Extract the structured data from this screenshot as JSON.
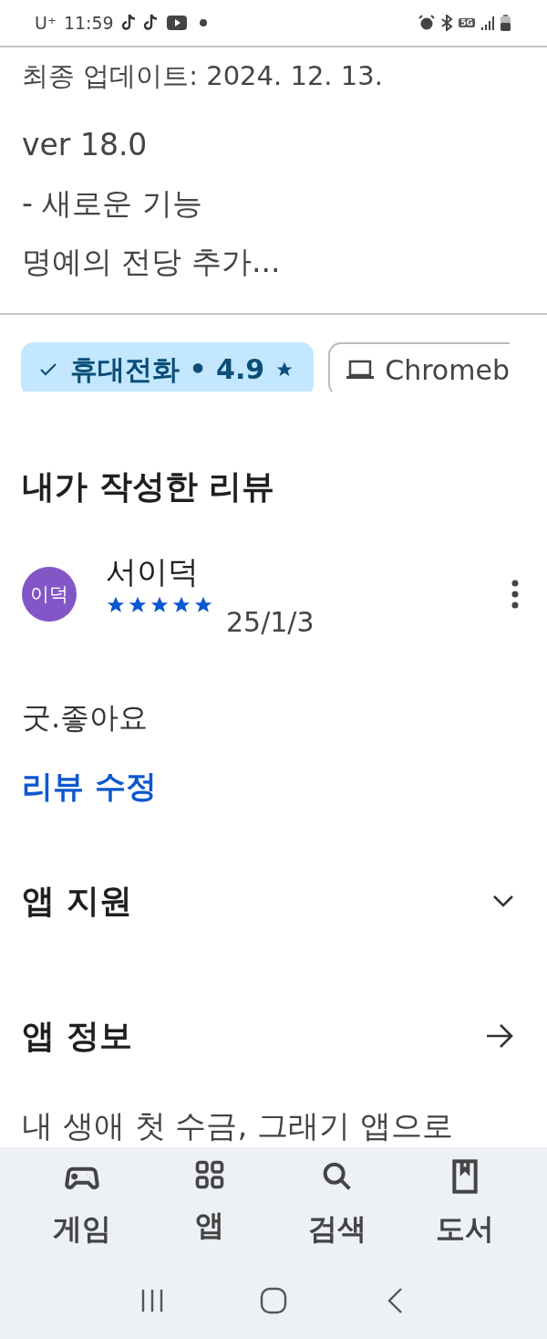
{
  "status_bar": {
    "carrier": "U⁺",
    "time": "11:59",
    "network": "5G"
  },
  "update": {
    "date_line": "최종 업데이트: 2024. 12. 13.",
    "lines": [
      "ver 18.0",
      "- 새로운 기능",
      "명예의 전당 추가..."
    ]
  },
  "device_chips": [
    {
      "kind": "phone",
      "label": "휴대전화 • 4.9",
      "selected": true
    },
    {
      "kind": "laptop",
      "label": "Chromeb",
      "selected": false
    }
  ],
  "my_review": {
    "title": "내가 작성한 리뷰",
    "avatar": "이덕",
    "name": "서이덕",
    "stars": 5,
    "date": "25/1/3",
    "text": "굿.좋아요",
    "edit_link": "리뷰 수정"
  },
  "sections": [
    {
      "kind": "expand",
      "title": "앱 지원",
      "expanded": false
    },
    {
      "kind": "link",
      "title": "앱 정보"
    }
  ],
  "cut_text": "내 생애 첫 수금, 그래기 앱으로",
  "bottom_nav": [
    {
      "kind": "games",
      "label": "게임",
      "selected": false
    },
    {
      "kind": "apps",
      "label": "앱",
      "selected": false
    },
    {
      "kind": "search",
      "label": "검색",
      "selected": false
    },
    {
      "kind": "books",
      "label": "도서",
      "selected": false
    }
  ]
}
